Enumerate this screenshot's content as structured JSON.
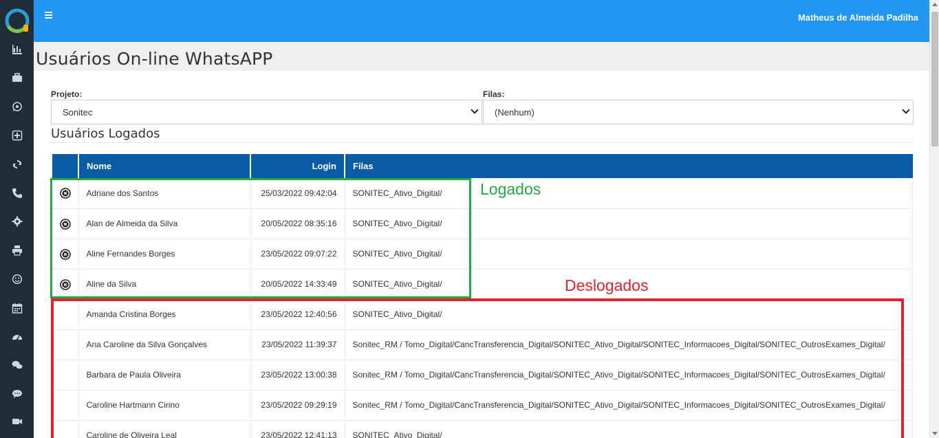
{
  "header": {
    "user_name": "Matheus de Almeida Padilha"
  },
  "page": {
    "title": "Usuários On-line WhatsAPP"
  },
  "form": {
    "projeto_label": "Projeto:",
    "projeto_value": "Sonitec",
    "filas_label": "Filas:",
    "filas_value": "(Nenhum)"
  },
  "section": {
    "title": "Usuários Logados"
  },
  "table": {
    "headers": {
      "nome": "Nome",
      "login": "Login",
      "filas": "Filas"
    },
    "rows": [
      {
        "nome": "Adriane dos Santos",
        "login": "25/03/2022 09:42:04",
        "filas": "SONITEC_Ativo_Digital/",
        "logged": true
      },
      {
        "nome": "Alan de Almeida da Silva",
        "login": "20/05/2022 08:35:16",
        "filas": "SONITEC_Ativo_Digital/",
        "logged": true
      },
      {
        "nome": "Aline Fernandes Borges",
        "login": "23/05/2022 09:07:22",
        "filas": "SONITEC_Ativo_Digital/",
        "logged": true
      },
      {
        "nome": "Aline da Silva",
        "login": "20/05/2022 14:33:49",
        "filas": "SONITEC_Ativo_Digital/",
        "logged": true
      },
      {
        "nome": "Amanda Cristina Borges",
        "login": "23/05/2022 12:40:56",
        "filas": "SONITEC_Ativo_Digital/",
        "logged": false
      },
      {
        "nome": "Ana Caroline da Silva Gonçalves",
        "login": "23/05/2022 11:39:37",
        "filas": "Sonitec_RM / Tomo_Digital/CancTransferencia_Digital/SONITEC_Ativo_Digital/SONITEC_Informacoes_Digital/SONITEC_OutrosExames_Digital/",
        "logged": false
      },
      {
        "nome": "Barbara de Paula Oliveira",
        "login": "23/05/2022 13:00:38",
        "filas": "Sonitec_RM / Tomo_Digital/CancTransferencia_Digital/SONITEC_Ativo_Digital/SONITEC_Informacoes_Digital/SONITEC_OutrosExames_Digital/",
        "logged": false
      },
      {
        "nome": "Caroline Hartmann Cirino",
        "login": "23/05/2022 09:29:19",
        "filas": "Sonitec_RM / Tomo_Digital/CancTransferencia_Digital/SONITEC_Ativo_Digital/SONITEC_Informacoes_Digital/SONITEC_OutrosExames_Digital/",
        "logged": false
      },
      {
        "nome": "Caroline de Oliveira Leal",
        "login": "23/05/2022 12:41:13",
        "filas": "SONITEC_Ativo_Digital/",
        "logged": false
      }
    ]
  },
  "annotations": {
    "logged": "Logados",
    "logged_out": "Deslogados"
  },
  "colors": {
    "topbar": "#2196f3",
    "sidebar": "#1f2d3a",
    "table_header": "#0a5ba6",
    "green": "#22a844",
    "red": "#e3232b"
  },
  "sidebar_icons": [
    "bar-chart-icon",
    "briefcase-icon",
    "whatsapp-icon",
    "plus-square-icon",
    "refresh-icon",
    "phone-icon",
    "gear-icon",
    "printer-icon",
    "smile-icon",
    "calendar-icon",
    "dashboard-icon",
    "comments-icon",
    "comment-icon",
    "video-icon"
  ]
}
